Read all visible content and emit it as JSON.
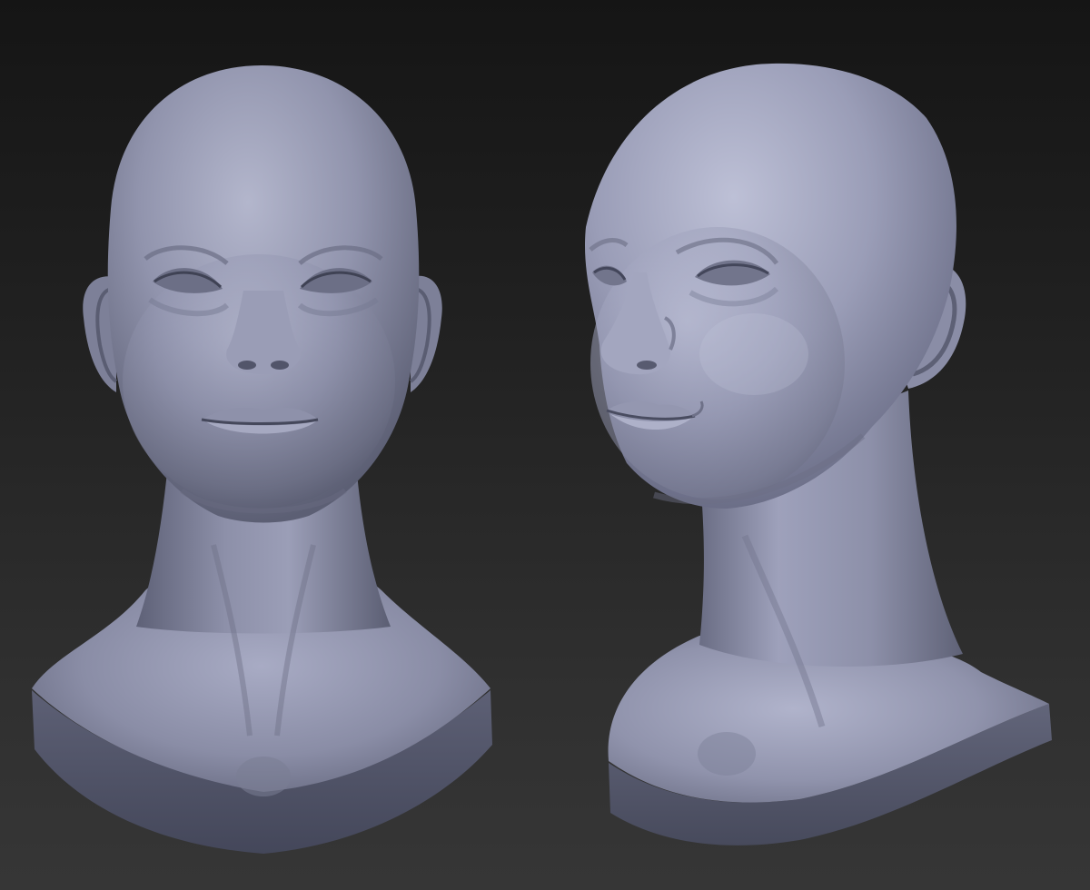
{
  "scene": {
    "subject": "sculpted-head-bust",
    "views": [
      "front",
      "three-quarter"
    ],
    "colors": {
      "background_top": "#151515",
      "background_bottom": "#363636",
      "material_base": "#8b8fa8",
      "material_highlight": "#c6c9de",
      "material_shadow": "#4f5266"
    }
  }
}
